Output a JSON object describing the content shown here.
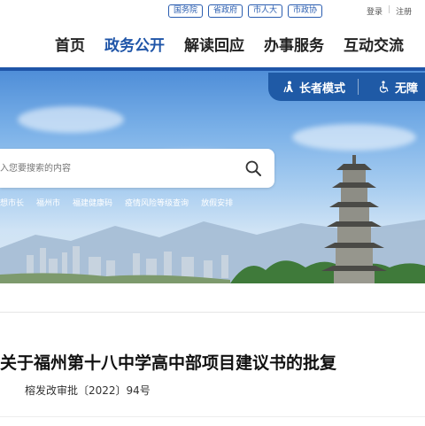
{
  "top_links": [
    "国务院",
    "省政府",
    "市人大",
    "市政协"
  ],
  "login": {
    "login_label": "登录",
    "separator": "|",
    "register_label": "注册"
  },
  "nav": {
    "items": [
      {
        "label": "首页",
        "active": false
      },
      {
        "label": "政务公开",
        "active": true
      },
      {
        "label": "解读回应",
        "active": false
      },
      {
        "label": "办事服务",
        "active": false
      },
      {
        "label": "互动交流",
        "active": false
      }
    ]
  },
  "accessibility": {
    "elder_mode_label": "长者模式",
    "barrier_free_label": "无障"
  },
  "search": {
    "placeholder": "入您要搜索的内容"
  },
  "quick_links": [
    "想市长",
    "福州市",
    "福建健康码",
    "疫情风险等级查询",
    "放假安排"
  ],
  "document": {
    "title": "关于福州第十八中学高中部项目建议书的批复",
    "number": "榕发改审批〔2022〕94号"
  },
  "colors": {
    "brand_blue": "#1f55a8",
    "nav_text": "#222222",
    "title_text": "#111111"
  }
}
